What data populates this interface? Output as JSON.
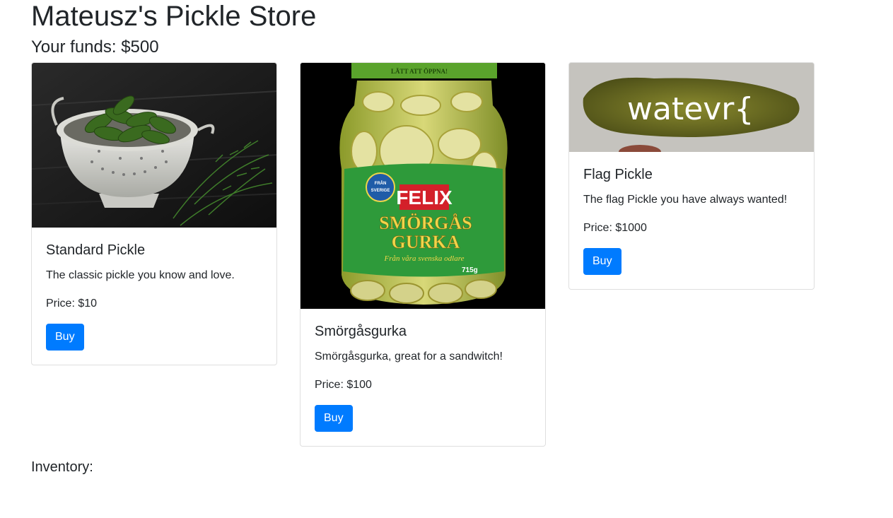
{
  "store": {
    "title": "Mateusz's Pickle Store",
    "funds_label": "Your funds: $500"
  },
  "products": [
    {
      "name": "Standard Pickle",
      "description": "The classic pickle you know and love.",
      "price_label": "Price: $10",
      "buy_label": "Buy",
      "image_icon": "colander-pickles-image"
    },
    {
      "name": "Smörgåsgurka",
      "description": "Smörgåsgurka, great for a sandwitch!",
      "price_label": "Price: $100",
      "buy_label": "Buy",
      "image_icon": "pickle-jar-image",
      "jar_lid_text": "LÄTT ATT ÖPPNA!",
      "jar_brand": "FELIX",
      "jar_product_line1": "SMÖRGÅS",
      "jar_product_line2": "GURKA",
      "jar_tagline": "Från våra svenska odlare",
      "jar_badge_line1": "FRÅN",
      "jar_badge_line2": "SVERIGE",
      "jar_weight": "715g"
    },
    {
      "name": "Flag Pickle",
      "description": "The flag Pickle you have always wanted!",
      "price_label": "Price: $1000",
      "buy_label": "Buy",
      "image_icon": "flag-pickle-image",
      "image_text": "watevr{"
    }
  ],
  "inventory": {
    "label": "Inventory:"
  },
  "colors": {
    "primary_button": "#007bff",
    "text": "#212529",
    "card_border": "#dfdfdf"
  }
}
